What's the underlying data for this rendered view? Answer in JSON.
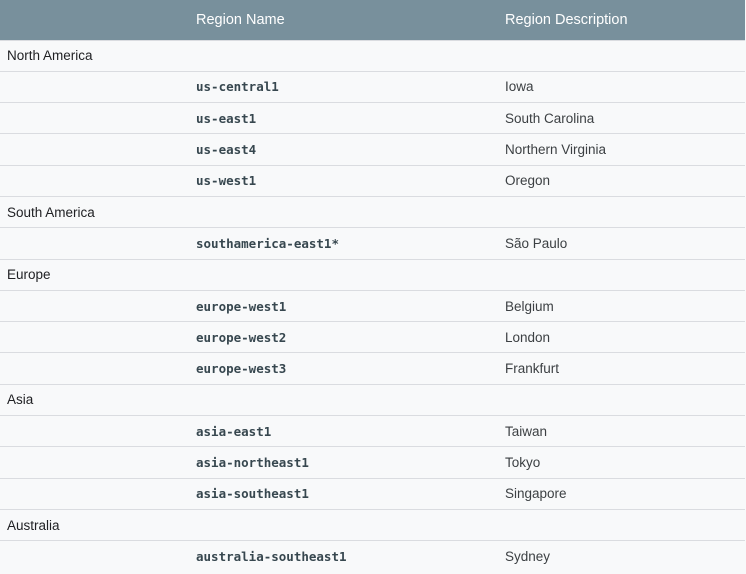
{
  "table": {
    "headers": {
      "group": "",
      "name": "Region Name",
      "description": "Region Description"
    },
    "groups": [
      {
        "label": "North America",
        "regions": [
          {
            "name": "us-central1",
            "description": "Iowa"
          },
          {
            "name": "us-east1",
            "description": "South Carolina"
          },
          {
            "name": "us-east4",
            "description": "Northern Virginia"
          },
          {
            "name": "us-west1",
            "description": "Oregon"
          }
        ]
      },
      {
        "label": "South America",
        "regions": [
          {
            "name": "southamerica-east1*",
            "description": "São Paulo"
          }
        ]
      },
      {
        "label": "Europe",
        "regions": [
          {
            "name": "europe-west1",
            "description": "Belgium"
          },
          {
            "name": "europe-west2",
            "description": "London"
          },
          {
            "name": "europe-west3",
            "description": "Frankfurt"
          }
        ]
      },
      {
        "label": "Asia",
        "regions": [
          {
            "name": "asia-east1",
            "description": "Taiwan"
          },
          {
            "name": "asia-northeast1",
            "description": "Tokyo"
          },
          {
            "name": "asia-southeast1",
            "description": "Singapore"
          }
        ]
      },
      {
        "label": "Australia",
        "regions": [
          {
            "name": "australia-southeast1",
            "description": "Sydney"
          }
        ]
      }
    ]
  },
  "colors": {
    "header_background": "#78909c",
    "header_text": "#ffffff",
    "row_background": "#f8f9fa",
    "row_border": "#dadce0"
  }
}
